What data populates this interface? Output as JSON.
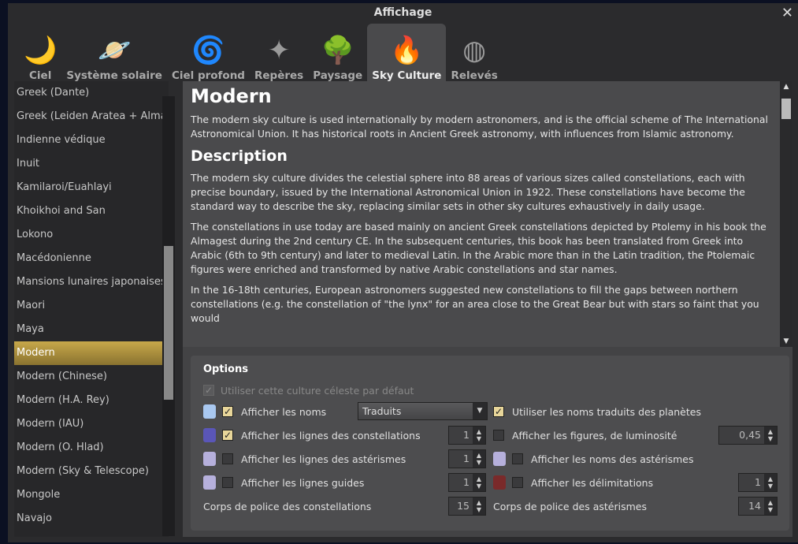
{
  "window": {
    "title": "Affichage",
    "close": "✕"
  },
  "tabs": [
    {
      "label": "Ciel",
      "icon": "🌙"
    },
    {
      "label": "Système solaire",
      "icon": "🪐"
    },
    {
      "label": "Ciel profond",
      "icon": "🌀"
    },
    {
      "label": "Repères",
      "icon": "✦"
    },
    {
      "label": "Paysage",
      "icon": "🌳"
    },
    {
      "label": "Sky Culture",
      "icon": "🔥"
    },
    {
      "label": "Relevés",
      "icon": "◍"
    }
  ],
  "cultures": [
    "Greek (Dante)",
    "Greek (Leiden Aratea + Alma...",
    "Indienne védique",
    "Inuit",
    "Kamilaroi/Euahlayi",
    "Khoikhoi and San",
    "Lokono",
    "Macédonienne",
    "Mansions lunaires japonaises",
    "Maori",
    "Maya",
    "Modern",
    "Modern (Chinese)",
    "Modern (H.A. Rey)",
    "Modern (IAU)",
    "Modern (O. Hlad)",
    "Modern (Sky & Telescope)",
    "Mongole",
    "Navajo"
  ],
  "selected": "Modern",
  "description": {
    "title": "Modern",
    "intro": "The modern sky culture is used internationally by modern astronomers, and is the official scheme of The International Astronomical Union. It has historical roots in Ancient Greek astronomy, with influences from Islamic astronomy.",
    "heading": "Description",
    "p1": "The modern sky culture divides the celestial sphere into 88 areas of various sizes called constellations, each with precise boundary, issued by the International Astronomical Union in 1922. These constellations have become the standard way to describe the sky, replacing similar sets in other sky cultures exhaustively in daily usage.",
    "p2": "The constellations in use today are based mainly on ancient Greek constellations depicted by Ptolemy in his book the Almagest during the 2nd century CE. In the subsequent centuries, this book has been translated from Greek into Arabic (6th to 9th century) and later to medieval Latin. In the Arabic more than in the Latin tradition, the Ptolemaic figures were enriched and transformed by native Arabic constellations and star names.",
    "p3": "In the 16-18th centuries, European astronomers suggested new constellations to fill the gaps between northern constellations (e.g. the constellation of \"the lynx\" for an area close to the Great Bear but with stars so faint that you would"
  },
  "options": {
    "title": "Options",
    "default_culture": "Utiliser cette culture céleste par défaut",
    "show_names": "Afficher les noms",
    "names_mode": "Traduits",
    "translated_planets": "Utiliser les noms traduits des planètes",
    "const_lines": "Afficher les lignes des constellations",
    "const_lines_width": "1",
    "figures": "Afficher les figures, de luminosité",
    "figures_brightness": "0,45",
    "asterism_lines": "Afficher les lignes des astérismes",
    "asterism_lines_width": "1",
    "asterism_names": "Afficher les noms des astérismes",
    "guide_lines": "Afficher les lignes guides",
    "guide_lines_width": "1",
    "boundaries": "Afficher les délimitations",
    "boundaries_width": "1",
    "const_font": "Corps de police des constellations",
    "const_font_size": "15",
    "asterism_font": "Corps de police des astérismes",
    "asterism_font_size": "14",
    "colors": {
      "names": "#a9c8f0",
      "const_lines": "#5a56b8",
      "asterism_lines": "#b6b0dc",
      "guide_lines": "#b6b0dc",
      "asterism_names": "#b6b0dc",
      "boundaries": "#7a2a2a"
    }
  }
}
